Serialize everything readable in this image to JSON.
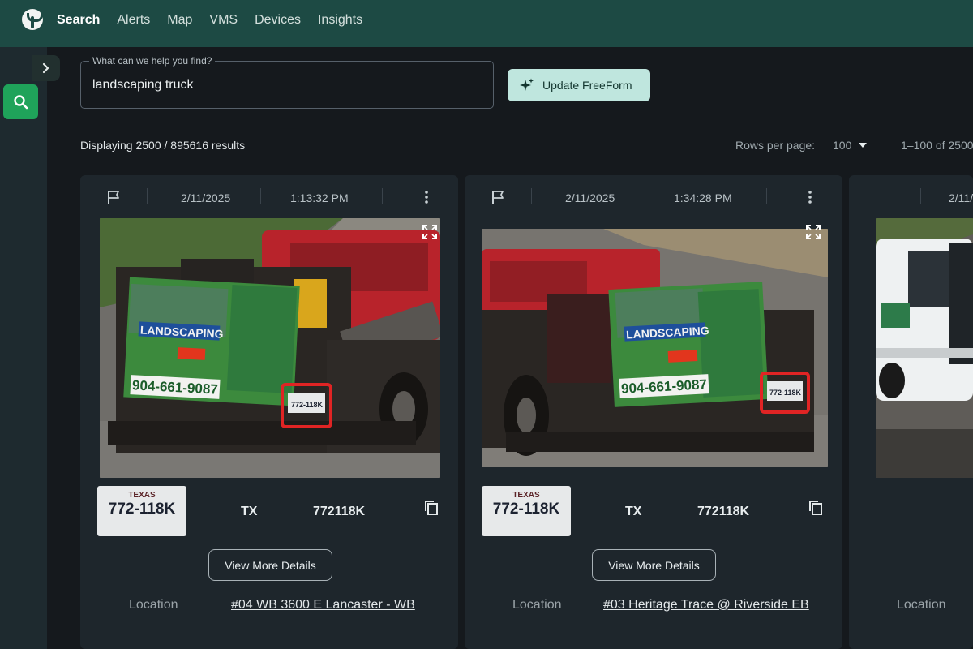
{
  "nav": {
    "items": [
      {
        "label": "Search",
        "active": true
      },
      {
        "label": "Alerts"
      },
      {
        "label": "Map"
      },
      {
        "label": "VMS"
      },
      {
        "label": "Devices"
      },
      {
        "label": "Insights"
      }
    ]
  },
  "search": {
    "legend": "What can we help you find?",
    "value": "landscaping truck",
    "button_label": "Update FreeForm"
  },
  "results": {
    "summary": "Displaying 2500 / 895616 results",
    "rows_per_page_label": "Rows per page:",
    "rows_per_page_value": "100",
    "range": "1–100 of 2500"
  },
  "cards": [
    {
      "date": "2/11/2025",
      "time": "1:13:32 PM",
      "state": "TX",
      "plate": "772118K",
      "plate_image_text": "772-118K",
      "plate_image_state": "TEXAS",
      "sign_phone": "904-661-9087",
      "sign_title": "LANDSCAPING",
      "details_button": "View More Details",
      "location_label": "Location",
      "location_value": "#04 WB 3600 E Lancaster - WB"
    },
    {
      "date": "2/11/2025",
      "time": "1:34:28 PM",
      "state": "TX",
      "plate": "772118K",
      "plate_image_text": "772-118K",
      "plate_image_state": "TEXAS",
      "sign_phone": "904-661-9087",
      "sign_title": "LANDSCAPING",
      "details_button": "View More Details",
      "location_label": "Location",
      "location_value": "#03 Heritage Trace @ Riverside EB"
    },
    {
      "date": "2/11/",
      "location_label": "Location"
    }
  ],
  "colors": {
    "topbar": "#1d4a44",
    "accent_green": "#1fa35a",
    "freeform_button": "#bfe6de",
    "highlight_box": "#e02424"
  },
  "icons": [
    "logo-icon",
    "chevron-right-icon",
    "search-icon",
    "sparkle-icon",
    "caret-down-icon",
    "flag-icon",
    "kebab-menu-icon",
    "fullscreen-icon",
    "copy-icon"
  ]
}
